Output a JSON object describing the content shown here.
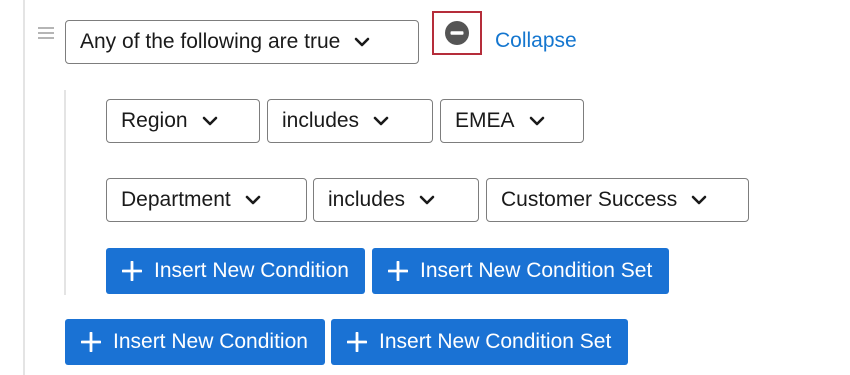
{
  "condition_set": {
    "logic_select": {
      "value": "Any of the following are true",
      "icon": "chevron-down-icon"
    },
    "remove_icon": "minus-circle-icon",
    "collapse_label": "Collapse",
    "conditions": [
      {
        "field": "Region",
        "operator": "includes",
        "value": "EMEA"
      },
      {
        "field": "Department",
        "operator": "includes",
        "value": "Customer Success"
      }
    ],
    "inner_buttons": {
      "insert_condition": "Insert New Condition",
      "insert_condition_set": "Insert New Condition Set"
    }
  },
  "outer_buttons": {
    "insert_condition": "Insert New Condition",
    "insert_condition_set": "Insert New Condition Set"
  },
  "colors": {
    "primary": "#1a72d4",
    "link": "#1476cf",
    "highlight_border": "#b52d3a",
    "remove_icon": "#555555"
  }
}
